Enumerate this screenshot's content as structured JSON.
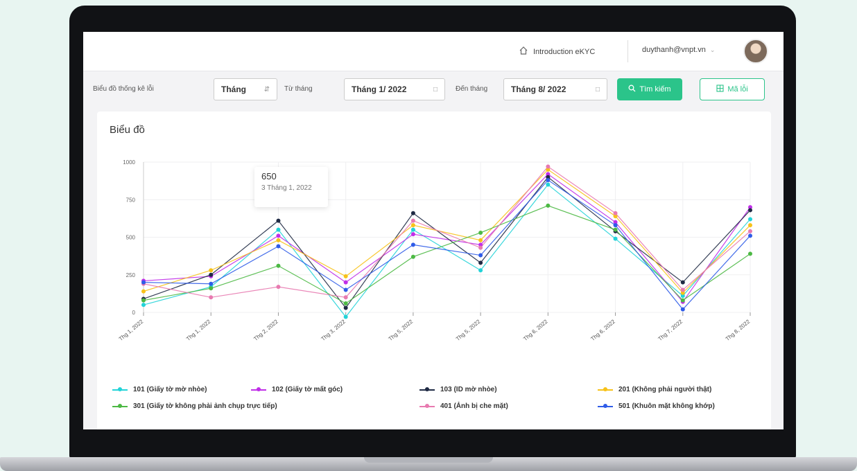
{
  "header": {
    "intro_label": "Introduction eKYC",
    "user_email": "duythanh@vnpt.vn"
  },
  "filters": {
    "title": "Biểu đồ thống kê lỗi",
    "period_value": "Tháng",
    "from_label": "Từ tháng",
    "from_value": "Tháng 1/ 2022",
    "to_label": "Đến tháng",
    "to_value": "Tháng 8/ 2022",
    "search_label": "Tìm kiếm",
    "code_label": "Mã lỗi"
  },
  "card": {
    "title": "Biểu đồ"
  },
  "tooltip": {
    "value": "650",
    "label": "3 Tháng 1, 2022"
  },
  "chart_data": {
    "type": "line",
    "title": "",
    "xlabel": "",
    "ylabel": "",
    "ylim": [
      0,
      1000
    ],
    "yticks": [
      "0",
      "250",
      "500",
      "750",
      "1000"
    ],
    "categories": [
      "Thg 1, 2022",
      "Thg 1, 2022",
      "Thg 2, 2022",
      "Thg 3, 2022",
      "Thg 5, 2022",
      "Thg 5, 2022",
      "Thg 6, 2022",
      "Thg 6, 2022",
      "Thg 7, 2022",
      "Thg 8, 2022"
    ],
    "grid": true,
    "legend_position": "bottom",
    "series": [
      {
        "name": "101 (Giấy tờ mờ nhòe)",
        "color": "#22d3d8",
        "values": [
          50,
          170,
          550,
          -30,
          550,
          280,
          850,
          490,
          110,
          620
        ]
      },
      {
        "name": "102 (Giấy tờ mất góc)",
        "color": "#c02ee8",
        "values": [
          210,
          240,
          510,
          200,
          520,
          450,
          920,
          600,
          70,
          700
        ]
      },
      {
        "name": "103 (ID mờ nhòe)",
        "color": "#1f2a44",
        "values": [
          90,
          250,
          610,
          30,
          660,
          330,
          900,
          540,
          200,
          680
        ]
      },
      {
        "name": "201 (Không phải người thật)",
        "color": "#f7c21a",
        "values": [
          140,
          280,
          480,
          240,
          580,
          480,
          950,
          640,
          130,
          580
        ]
      },
      {
        "name": "301 (Giấy tờ không phải ảnh chụp trực tiếp)",
        "color": "#4cb944",
        "values": [
          80,
          160,
          310,
          60,
          370,
          530,
          710,
          550,
          80,
          390
        ]
      },
      {
        "name": "401 (Ảnh bị che mặt)",
        "color": "#e87ab0",
        "values": [
          190,
          100,
          170,
          100,
          610,
          430,
          970,
          660,
          150,
          540
        ]
      },
      {
        "name": "501 (Khuôn mặt không khớp)",
        "color": "#2f5ce8",
        "values": [
          200,
          190,
          440,
          150,
          450,
          380,
          880,
          580,
          20,
          510
        ]
      }
    ]
  }
}
